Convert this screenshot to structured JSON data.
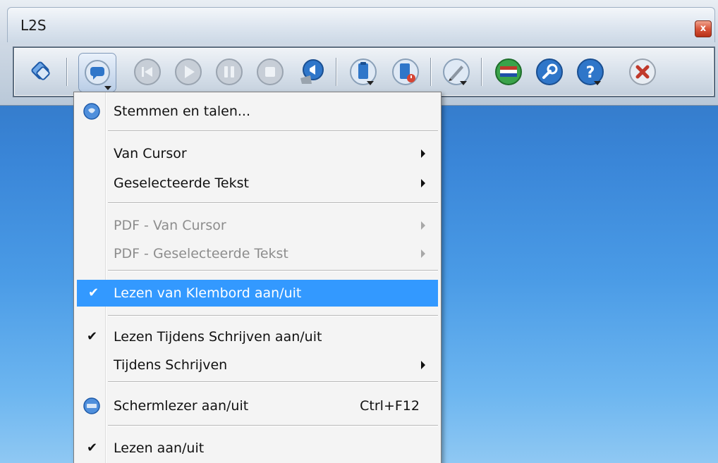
{
  "window": {
    "title": "L2S",
    "close_symbol": "x"
  },
  "toolbar": {
    "buttons": [
      {
        "name": "settings-refresh-icon",
        "color": "#3a7fd0"
      },
      {
        "name": "speech-bubble-dropdown-icon",
        "color": "#2f76c9"
      },
      {
        "name": "skip-back-icon",
        "color": "#aab3bf"
      },
      {
        "name": "play-icon",
        "color": "#aab3bf"
      },
      {
        "name": "pause-icon",
        "color": "#aab3bf"
      },
      {
        "name": "stop-icon",
        "color": "#aab3bf"
      },
      {
        "name": "speaker-icon",
        "color": "#2f76c9"
      },
      {
        "name": "clipboard-doc-icon",
        "color": "#2f76c9"
      },
      {
        "name": "clipboard-power-icon",
        "color": "#2f76c9"
      },
      {
        "name": "pen-icon",
        "color": "#2f76c9"
      },
      {
        "name": "dutch-flag-icon",
        "color": "#c0392b"
      },
      {
        "name": "wrench-icon",
        "color": "#2f76c9"
      },
      {
        "name": "help-icon",
        "color": "#2f76c9"
      },
      {
        "name": "exit-icon",
        "color": "#c0392b"
      }
    ]
  },
  "menu": {
    "items": [
      {
        "label": "Stemmen en talen...",
        "icon": "voices-icon"
      },
      {
        "label": "Van Cursor"
      },
      {
        "label": "Geselecteerde Tekst"
      },
      {
        "label": "PDF - Van Cursor"
      },
      {
        "label": "PDF - Geselecteerde Tekst"
      },
      {
        "label": "Lezen van Klembord aan/uit",
        "check": "✔"
      },
      {
        "label": "Lezen Tijdens Schrijven aan/uit",
        "check": "✔"
      },
      {
        "label": "Tijdens Schrijven"
      },
      {
        "label": "Schermlezer aan/uit",
        "shortcut": "Ctrl+F12",
        "icon": "screenreader-icon"
      },
      {
        "label": "Lezen aan/uit",
        "check": "✔"
      }
    ]
  },
  "colors": {
    "highlight": "#3399ff",
    "disabled_text": "#8d8d8d",
    "desktop": "#3a86d8"
  }
}
